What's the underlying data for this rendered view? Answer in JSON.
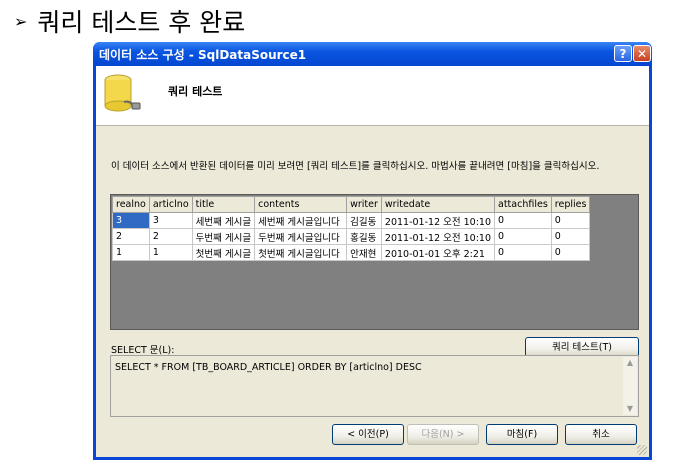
{
  "slide": {
    "bullet": "➢",
    "title": "쿼리 테스트 후 완료"
  },
  "window": {
    "title": "데이터 소스 구성 - SqlDataSource1",
    "help_glyph": "?",
    "close_glyph": "✕",
    "header_title": "쿼리 테스트",
    "description": "이 데이터 소스에서 반환된 데이터를 미리 보려면 [쿼리 테스트]를 클릭하십시오. 마법사를 끝내려면 [마침]을 클릭하십시오.",
    "columns": [
      "realno",
      "articlno",
      "title",
      "contents",
      "writer",
      "writedate",
      "attachfiles",
      "replies"
    ],
    "rows": [
      [
        "3",
        "3",
        "세번째 게시글",
        "세번째 게시글입니다",
        "김길동",
        "2011-01-12 오전 10:10",
        "0",
        "0"
      ],
      [
        "2",
        "2",
        "두번째 게시글",
        "두번째 게시글입니다",
        "홍길동",
        "2011-01-12 오전 10:10",
        "0",
        "0"
      ],
      [
        "1",
        "1",
        "첫번째 게시글",
        "첫번째 게시글입니다",
        "안재현",
        "2010-01-01 오후 2:21",
        "0",
        "0"
      ]
    ],
    "test_query_button": "쿼리 테스트(T)",
    "sql_label": "SELECT 문(L):",
    "sql_text": "SELECT * FROM [TB_BOARD_ARTICLE] ORDER BY [articlno] DESC",
    "buttons": {
      "prev": "< 이전(P)",
      "next": "다음(N) >",
      "finish": "마침(F)",
      "cancel": "취소"
    }
  },
  "colors": {
    "titlebar": "#0a55e0",
    "dialog_bg": "#ece9d8",
    "grid_bg": "#808080",
    "selection": "#316ac5"
  }
}
